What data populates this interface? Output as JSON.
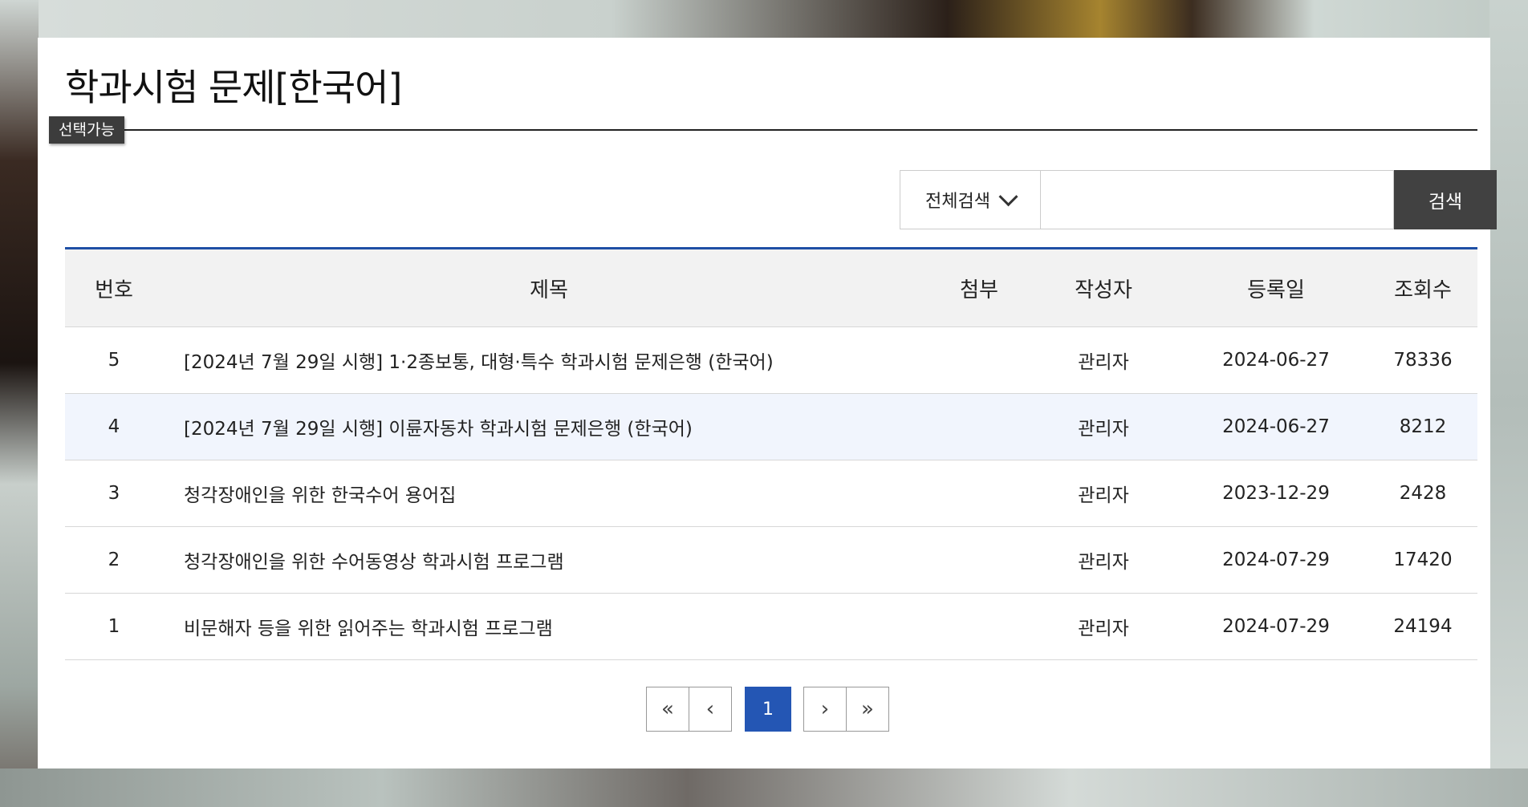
{
  "header": {
    "title": "학과시험 문제[한국어]",
    "badge": "선택가능"
  },
  "search": {
    "select_value": "전체검색",
    "input_value": "",
    "button_label": "검색"
  },
  "table": {
    "columns": [
      "번호",
      "제목",
      "첨부",
      "작성자",
      "등록일",
      "조회수"
    ],
    "rows": [
      {
        "no": "5",
        "title": "[2024년 7월 29일 시행] 1·2종보통, 대형·특수 학과시험 문제은행 (한국어)",
        "attach": "",
        "author": "관리자",
        "date": "2024-06-27",
        "views": "78336"
      },
      {
        "no": "4",
        "title": "[2024년 7월 29일 시행] 이륜자동차 학과시험 문제은행 (한국어)",
        "attach": "",
        "author": "관리자",
        "date": "2024-06-27",
        "views": "8212"
      },
      {
        "no": "3",
        "title": "청각장애인을 위한 한국수어 용어집",
        "attach": "",
        "author": "관리자",
        "date": "2023-12-29",
        "views": "2428"
      },
      {
        "no": "2",
        "title": "청각장애인을 위한 수어동영상 학과시험 프로그램",
        "attach": "",
        "author": "관리자",
        "date": "2024-07-29",
        "views": "17420"
      },
      {
        "no": "1",
        "title": "비문해자 등을 위한 읽어주는 학과시험 프로그램",
        "attach": "",
        "author": "관리자",
        "date": "2024-07-29",
        "views": "24194"
      }
    ]
  },
  "pagination": {
    "first": "«",
    "prev": "‹",
    "current": "1",
    "next": "›",
    "last": "»"
  },
  "colors": {
    "accent": "#2456b4",
    "header_rule": "#1f4fa5",
    "search_button": "#414141",
    "highlight_row": "#f1f5fd"
  }
}
